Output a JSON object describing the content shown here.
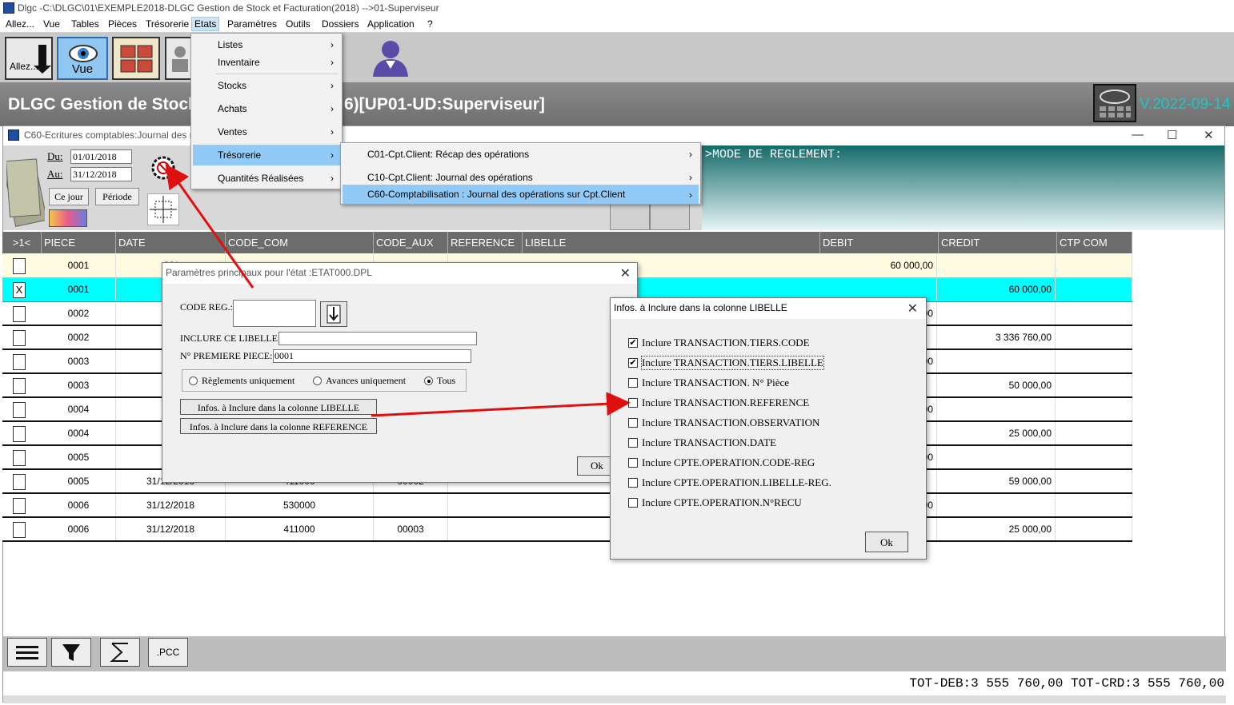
{
  "window": {
    "title": "Dlgc -C:\\DLGC\\01\\EXEMPLE2018-DLGC Gestion de Stock et Facturation(2018) -->01-Superviseur"
  },
  "menubar": {
    "items": [
      "Allez...",
      "Vue",
      "Tables",
      "Pièces",
      "Trésorerie",
      "Etats",
      "Paramètres",
      "Outils",
      "Dossiers",
      "Application",
      "?"
    ]
  },
  "toolbar": {
    "allez_label": "Allez...",
    "vue_label": "Vue"
  },
  "header": {
    "title": "DLGC Gestion de Stock",
    "user": "6)[UP01-UD:Superviseur]",
    "version": "V.2022-09-14"
  },
  "child": {
    "title": "C60-Ecritures comptables:Journal des r",
    "du_label": "Du:",
    "du_value": "01/01/2018",
    "au_label": "Au:",
    "au_value": "31/12/2018",
    "cejour_label": "Ce jour",
    "periode_label": "Période",
    "mode_text": ">MODE DE REGLEMENT:"
  },
  "etats_menu": {
    "items": [
      "Listes",
      "Inventaire",
      "Stocks",
      "Achats",
      "Ventes",
      "Trésorerie",
      "Quantités Réalisées"
    ]
  },
  "tresorerie_menu": {
    "items": [
      "C01-Cpt.Client: Récap des opérations",
      "C10-Cpt.Client: Journal des opérations",
      "C60-Comptabilisation : Journal des opérations sur Cpt.Client"
    ]
  },
  "grid": {
    "columns": [
      ">1<",
      "PIECE",
      "DATE",
      "CODE_COM",
      "CODE_AUX",
      "REFERENCE",
      "LIBELLE",
      "DEBIT",
      "CREDIT",
      "CTP COM"
    ],
    "rows": [
      {
        "check": "",
        "piece": "0001",
        "date": "30/",
        "code_com": "",
        "code_aux": "",
        "debit": "60 000,00",
        "credit": "",
        "ctp": ""
      },
      {
        "check": "X",
        "piece": "0001",
        "date": "30/",
        "code_com": "",
        "code_aux": "",
        "debit": "",
        "credit": "60 000,00",
        "ctp": ""
      },
      {
        "check": "",
        "piece": "0002",
        "date": "26/",
        "code_com": "",
        "code_aux": "",
        "debit": "00",
        "credit": "",
        "ctp": ""
      },
      {
        "check": "",
        "piece": "0002",
        "date": "26/",
        "code_com": "",
        "code_aux": "",
        "debit": "",
        "credit": "3 336 760,00",
        "ctp": ""
      },
      {
        "check": "",
        "piece": "0003",
        "date": "31/",
        "code_com": "",
        "code_aux": "",
        "debit": "00",
        "credit": "",
        "ctp": ""
      },
      {
        "check": "",
        "piece": "0003",
        "date": "31/",
        "code_com": "",
        "code_aux": "",
        "debit": "",
        "credit": "50 000,00",
        "ctp": ""
      },
      {
        "check": "",
        "piece": "0004",
        "date": "31/",
        "code_com": "",
        "code_aux": "",
        "debit": "00",
        "credit": "",
        "ctp": ""
      },
      {
        "check": "",
        "piece": "0004",
        "date": "31/",
        "code_com": "",
        "code_aux": "",
        "debit": "",
        "credit": "25 000,00",
        "ctp": ""
      },
      {
        "check": "",
        "piece": "0005",
        "date": "31/",
        "code_com": "",
        "code_aux": "",
        "debit": "00",
        "credit": "",
        "ctp": ""
      },
      {
        "check": "",
        "piece": "0005",
        "date": "31/12/2018",
        "code_com": "411000",
        "code_aux": "00002",
        "debit": "",
        "credit": "59 000,00",
        "ctp": ""
      },
      {
        "check": "",
        "piece": "0006",
        "date": "31/12/2018",
        "code_com": "530000",
        "code_aux": "",
        "debit": "00",
        "credit": "",
        "ctp": ""
      },
      {
        "check": "",
        "piece": "0006",
        "date": "31/12/2018",
        "code_com": "411000",
        "code_aux": "00003",
        "debit": "",
        "credit": "25 000,00",
        "ctp": ""
      }
    ]
  },
  "bottom": {
    "pcc_label": ".PCC",
    "totals": "TOT-DEB:3 555 760,00 TOT-CRD:3 555 760,00"
  },
  "param_dialog": {
    "title": "Paramètres principaux pour l'état :ETAT000.DPL",
    "code_reg_label": "CODE REG.:",
    "code_reg_value": "",
    "inclure_label": "INCLURE CE LIBELLE:",
    "inclure_value": "",
    "premiere_label": "N° PREMIERE PIECE:",
    "premiere_value": "0001",
    "radio_options": [
      "Règlements uniquement",
      "Avances uniquement",
      "Tous"
    ],
    "radio_selected": "Tous",
    "btn_libelle": "Infos. à Inclure dans la colonne LIBELLE",
    "btn_reference": "Infos. à Inclure dans la colonne REFERENCE",
    "ok_label": "Ok"
  },
  "libelle_dialog": {
    "title": "Infos. à Inclure dans la colonne LIBELLE",
    "options": [
      {
        "label": "Inclure TRANSACTION.TIERS.CODE",
        "checked": true
      },
      {
        "label": "Inclure TRANSACTION.TIERS.LIBELLE",
        "checked": true
      },
      {
        "label": "Inclure TRANSACTION. N° Pièce",
        "checked": false
      },
      {
        "label": "Inclure TRANSACTION.REFERENCE",
        "checked": false
      },
      {
        "label": "Inclure TRANSACTION.OBSERVATION",
        "checked": false
      },
      {
        "label": "Inclure TRANSACTION.DATE",
        "checked": false
      },
      {
        "label": "Inclure CPTE.OPERATION.CODE-REG",
        "checked": false
      },
      {
        "label": "Inclure CPTE.OPERATION.LIBELLE-REG.",
        "checked": false
      },
      {
        "label": "Inclure CPTE.OPERATION.N°RECU",
        "checked": false
      }
    ],
    "ok_label": "Ok"
  },
  "colors": {
    "accent_teal": "#18c8c8",
    "selected_row": "#00ffff",
    "menu_highlight": "#91c9f7",
    "arrow": "#e01010"
  }
}
